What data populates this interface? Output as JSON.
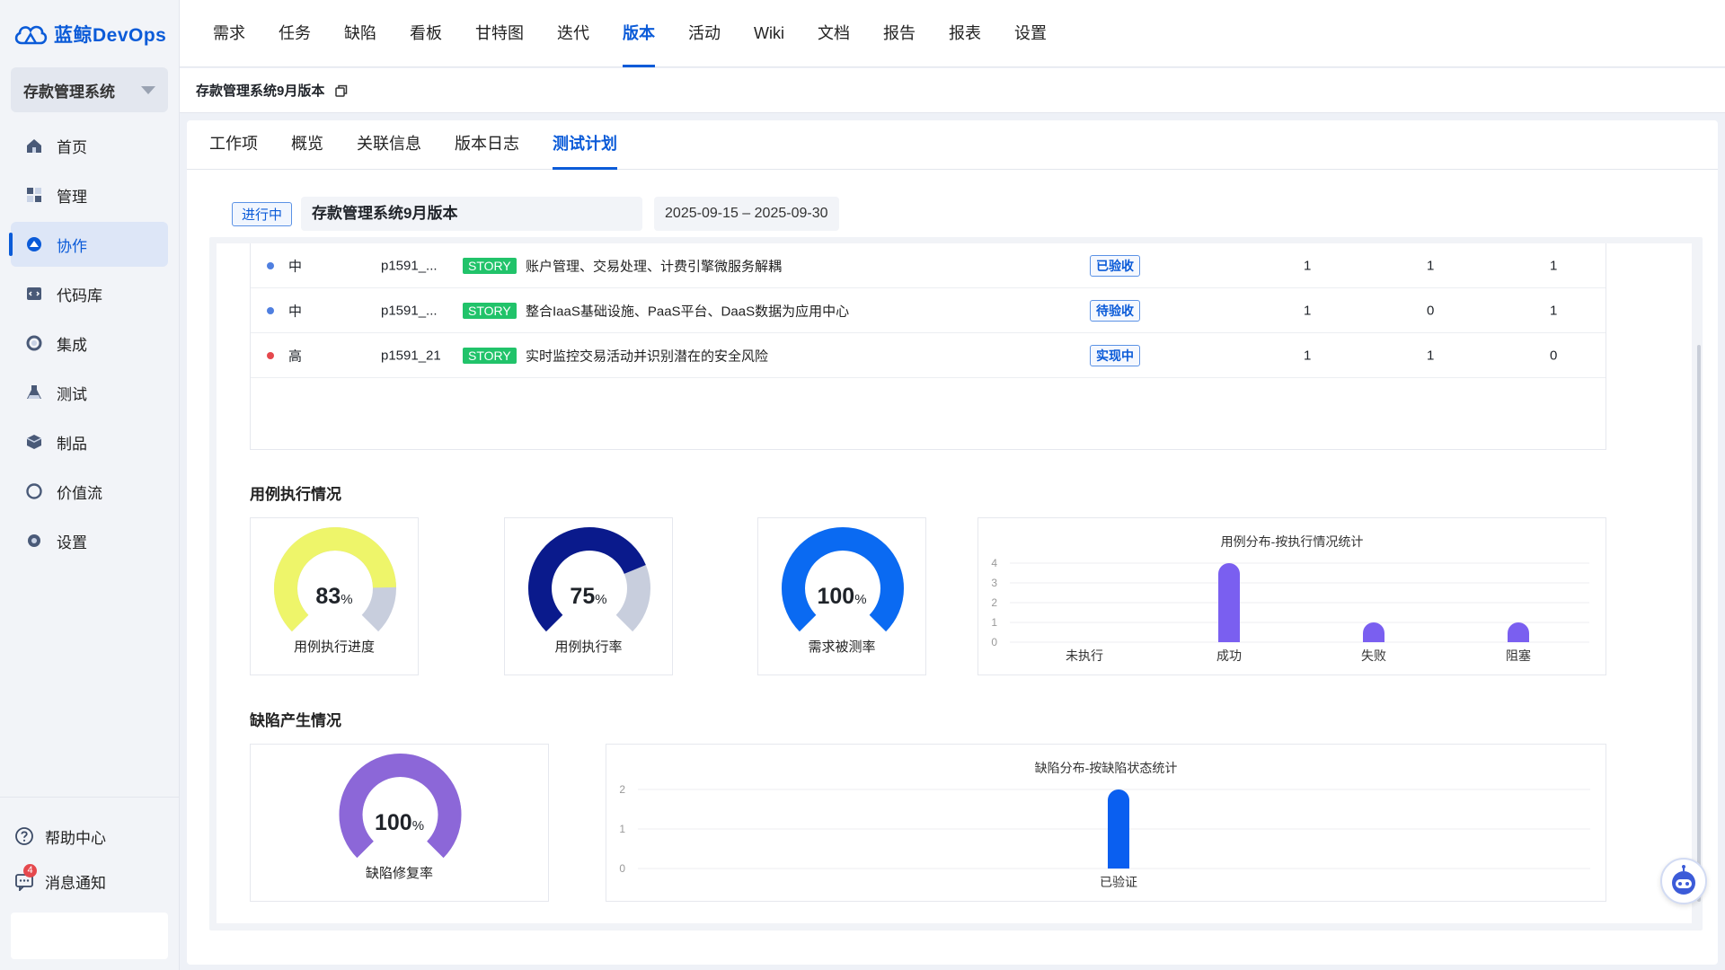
{
  "app": {
    "name": "蓝鲸DevOps",
    "project": "存款管理系统"
  },
  "sidebar": {
    "items": [
      {
        "label": "首页",
        "icon": "home-icon"
      },
      {
        "label": "管理",
        "icon": "manage-icon"
      },
      {
        "label": "协作",
        "icon": "collaboration-icon",
        "active": true
      },
      {
        "label": "代码库",
        "icon": "code-repo-icon"
      },
      {
        "label": "集成",
        "icon": "integration-icon"
      },
      {
        "label": "测试",
        "icon": "test-flask-icon"
      },
      {
        "label": "制品",
        "icon": "artifact-box-icon"
      },
      {
        "label": "价值流",
        "icon": "value-stream-icon"
      },
      {
        "label": "设置",
        "icon": "gear-icon"
      }
    ],
    "bottom": [
      {
        "label": "帮助中心",
        "icon": "help-circle-icon"
      },
      {
        "label": "消息通知",
        "icon": "message-icon",
        "badge": "4"
      }
    ]
  },
  "topnav": {
    "tabs": [
      "需求",
      "任务",
      "缺陷",
      "看板",
      "甘特图",
      "迭代",
      "版本",
      "活动",
      "Wiki",
      "文档",
      "报告",
      "报表",
      "设置"
    ],
    "active": "版本"
  },
  "breadcrumb": {
    "title": "存款管理系统9月版本"
  },
  "subtabs": {
    "tabs": [
      "工作项",
      "概览",
      "关联信息",
      "版本日志",
      "测试计划"
    ],
    "active": "测试计划"
  },
  "plan": {
    "status": "进行中",
    "name": "存款管理系统9月版本",
    "date_range": "2025-09-15 – 2025-09-30"
  },
  "stories": [
    {
      "priority": "中",
      "dot_color": "#4f7fe0",
      "code": "p1591_...",
      "tag": "STORY",
      "title": "账户管理、交易处理、计费引擎微服务解耦",
      "state": "已验收",
      "c1": "1",
      "c2": "1",
      "c3": "1"
    },
    {
      "priority": "中",
      "dot_color": "#4f7fe0",
      "code": "p1591_...",
      "tag": "STORY",
      "title": "整合IaaS基础设施、PaaS平台、DaaS数据为应用中心",
      "state": "待验收",
      "c1": "1",
      "c2": "0",
      "c3": "1"
    },
    {
      "priority": "高",
      "dot_color": "#e5484d",
      "code": "p1591_21",
      "tag": "STORY",
      "title": "实时监控交易活动并识别潜在的安全风险",
      "state": "实现中",
      "c1": "1",
      "c2": "1",
      "c3": "0"
    }
  ],
  "case_section": {
    "title": "用例执行情况",
    "gauges": [
      {
        "value": "83",
        "unit": "%",
        "label": "用例执行进度",
        "fraction": 0.83,
        "color": "#eef56a"
      },
      {
        "value": "75",
        "unit": "%",
        "label": "用例执行率",
        "fraction": 0.75,
        "color": "#0a1a8c"
      },
      {
        "value": "100",
        "unit": "%",
        "label": "需求被测率",
        "fraction": 1.0,
        "color": "#0a6af2"
      }
    ]
  },
  "defect_section": {
    "title": "缺陷产生情况",
    "gauge": {
      "value": "100",
      "unit": "%",
      "label": "缺陷修复率",
      "fraction": 1.0,
      "color": "#8c67d8"
    }
  },
  "chart_data": [
    {
      "type": "bar",
      "title": "用例分布-按执行情况统计",
      "categories": [
        "未执行",
        "成功",
        "失败",
        "阻塞"
      ],
      "values": [
        0,
        4,
        1,
        1
      ],
      "ylim": [
        0,
        4
      ],
      "yticks": [
        0,
        1,
        2,
        3,
        4
      ],
      "color": "#7a5ff0",
      "grid": true
    },
    {
      "type": "bar",
      "title": "缺陷分布-按缺陷状态统计",
      "categories": [
        "已验证"
      ],
      "values": [
        2
      ],
      "ylim": [
        0,
        2
      ],
      "yticks": [
        0,
        1,
        2
      ],
      "color": "#0a5ff0",
      "grid": true
    }
  ]
}
